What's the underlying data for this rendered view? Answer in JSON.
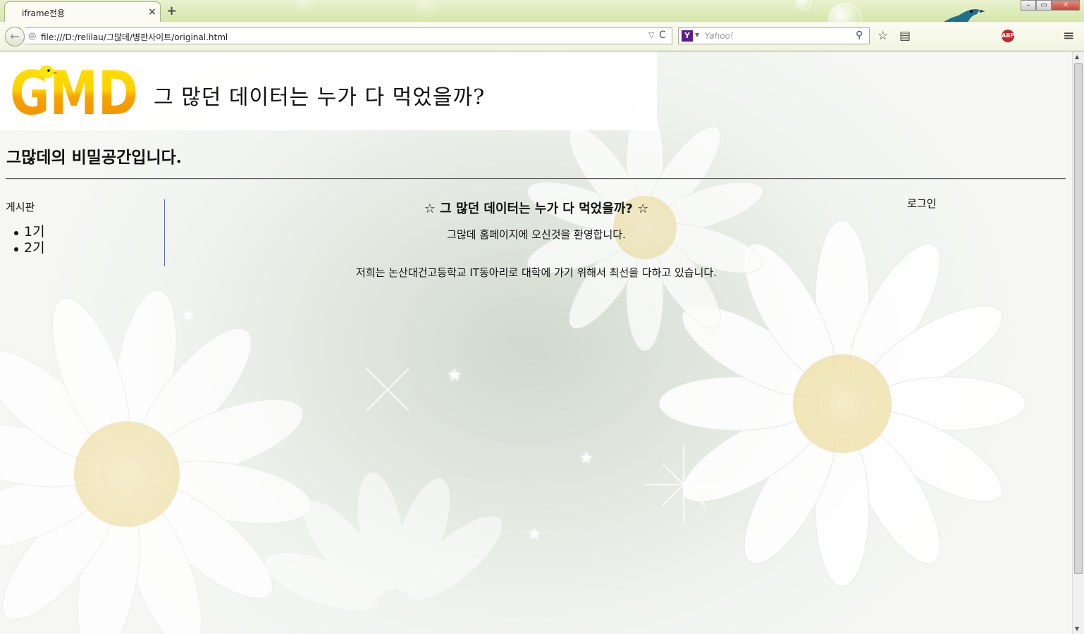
{
  "browser": {
    "tab_title": "iframe전용",
    "tab_close": "×",
    "new_tab": "+",
    "url": "file:///D:/relilau/그많데/병판사이트/original.html",
    "search_placeholder": "Yahoo!",
    "search_engine_letter": "Y",
    "back_glyph": "←",
    "url_dropdown": "▽",
    "reload_glyph": "C",
    "search_glyph": "⚲",
    "bookmark_glyph": "☆",
    "reader_glyph": "▤",
    "menu_glyph": "≡",
    "abp_label": "ABP",
    "window_buttons": [
      "–",
      "▭",
      "✕"
    ]
  },
  "header": {
    "logo_text": "GMD",
    "site_title": "그 많던 데이터는 누가 다 먹었을까?"
  },
  "intro": "그많데의 비밀공간입니다.",
  "sidebar": {
    "heading": "게시판",
    "items": [
      "1기",
      "2기"
    ]
  },
  "main": {
    "title": "☆ 그 많던 데이터는 누가 다 먹었을까? ☆",
    "welcome": "그많데 홈페이지에 오신것을 환영합니다.",
    "description": "저희는 논산대건고등학교 IT동아리로 대학에 가기 위해서 최선을 다하고 있습니다."
  },
  "login": "로그인",
  "icons": {
    "back": "back-arrow-icon",
    "site": "globe-icon",
    "reload": "reload-icon",
    "search": "magnifier-icon",
    "bookmark": "star-icon",
    "menu": "hamburger-icon"
  },
  "colors": {
    "chrome_theme": "#d5e6a8",
    "logo_yellow": "#ffe600",
    "logo_orange": "#f39a00",
    "sidebar_divider": "#5a6ea8"
  }
}
